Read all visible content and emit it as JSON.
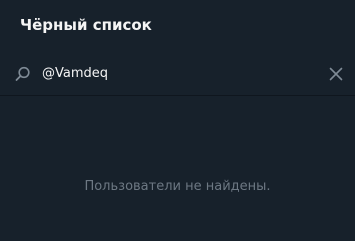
{
  "header": {
    "title": "Чёрный список"
  },
  "search": {
    "icon": "search-icon",
    "value": "@Vamdeq",
    "clear_icon": "close-icon"
  },
  "results": {
    "empty_message": "Пользователи не найдены."
  },
  "colors": {
    "background": "#17212b",
    "text_primary": "#f5f5f5",
    "text_muted": "#6d7883",
    "icon": "#7f8b96",
    "divider": "#0f161e"
  }
}
